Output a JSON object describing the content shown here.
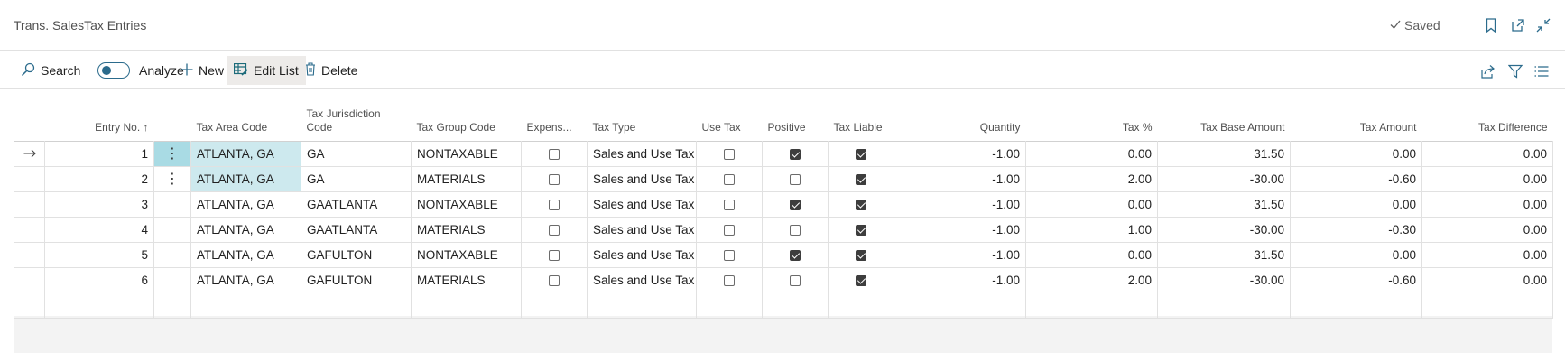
{
  "header": {
    "title": "Trans. SalesTax Entries",
    "saved_label": "Saved",
    "icons": [
      "bookmark-icon",
      "open-in-new-window-icon",
      "collapse-icon"
    ]
  },
  "toolbar": {
    "search_label": "Search",
    "analyze_label": "Analyze",
    "new_label": "New",
    "edit_list_label": "Edit List",
    "delete_label": "Delete",
    "right_icons": [
      "share-icon",
      "filter-icon",
      "list-view-icon"
    ]
  },
  "columns": {
    "entry_no": "Entry No. ↑",
    "tax_area_code": "Tax Area Code",
    "tax_jurisdiction_code": "Tax Jurisdiction Code",
    "tax_group_code": "Tax Group Code",
    "expense": "Expens...",
    "tax_type": "Tax Type",
    "use_tax": "Use Tax",
    "positive": "Positive",
    "tax_liable": "Tax Liable",
    "quantity": "Quantity",
    "tax_pct": "Tax %",
    "tax_base_amount": "Tax Base Amount",
    "tax_amount": "Tax Amount",
    "tax_difference": "Tax Difference"
  },
  "rows": [
    {
      "entry_no": "1",
      "tax_area_code": "ATLANTA, GA",
      "tax_jurisdiction_code": "GA",
      "tax_group_code": "NONTAXABLE",
      "expense": false,
      "tax_type": "Sales and Use Tax",
      "use_tax": false,
      "positive": true,
      "tax_liable": true,
      "quantity": "-1.00",
      "tax_pct": "0.00",
      "tax_base_amount": "31.50",
      "tax_amount": "0.00",
      "tax_difference": "0.00"
    },
    {
      "entry_no": "2",
      "tax_area_code": "ATLANTA, GA",
      "tax_jurisdiction_code": "GA",
      "tax_group_code": "MATERIALS",
      "expense": false,
      "tax_type": "Sales and Use Tax",
      "use_tax": false,
      "positive": false,
      "tax_liable": true,
      "quantity": "-1.00",
      "tax_pct": "2.00",
      "tax_base_amount": "-30.00",
      "tax_amount": "-0.60",
      "tax_difference": "0.00"
    },
    {
      "entry_no": "3",
      "tax_area_code": "ATLANTA, GA",
      "tax_jurisdiction_code": "GAATLANTA",
      "tax_group_code": "NONTAXABLE",
      "expense": false,
      "tax_type": "Sales and Use Tax",
      "use_tax": false,
      "positive": true,
      "tax_liable": true,
      "quantity": "-1.00",
      "tax_pct": "0.00",
      "tax_base_amount": "31.50",
      "tax_amount": "0.00",
      "tax_difference": "0.00"
    },
    {
      "entry_no": "4",
      "tax_area_code": "ATLANTA, GA",
      "tax_jurisdiction_code": "GAATLANTA",
      "tax_group_code": "MATERIALS",
      "expense": false,
      "tax_type": "Sales and Use Tax",
      "use_tax": false,
      "positive": false,
      "tax_liable": true,
      "quantity": "-1.00",
      "tax_pct": "1.00",
      "tax_base_amount": "-30.00",
      "tax_amount": "-0.30",
      "tax_difference": "0.00"
    },
    {
      "entry_no": "5",
      "tax_area_code": "ATLANTA, GA",
      "tax_jurisdiction_code": "GAFULTON",
      "tax_group_code": "NONTAXABLE",
      "expense": false,
      "tax_type": "Sales and Use Tax",
      "use_tax": false,
      "positive": true,
      "tax_liable": true,
      "quantity": "-1.00",
      "tax_pct": "0.00",
      "tax_base_amount": "31.50",
      "tax_amount": "0.00",
      "tax_difference": "0.00"
    },
    {
      "entry_no": "6",
      "tax_area_code": "ATLANTA, GA",
      "tax_jurisdiction_code": "GAFULTON",
      "tax_group_code": "MATERIALS",
      "expense": false,
      "tax_type": "Sales and Use Tax",
      "use_tax": false,
      "positive": false,
      "tax_liable": true,
      "quantity": "-1.00",
      "tax_pct": "2.00",
      "tax_base_amount": "-30.00",
      "tax_amount": "-0.60",
      "tax_difference": "0.00"
    }
  ],
  "colors": {
    "accent": "#2b6b8c",
    "selected_cell": "#cde9ee",
    "selected_dots": "#a9dbe4"
  }
}
